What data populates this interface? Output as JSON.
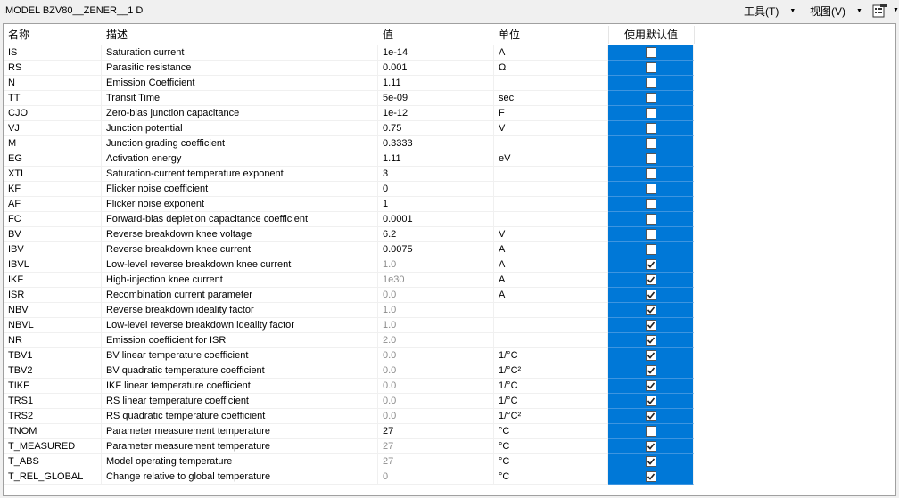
{
  "window": {
    "title": ".MODEL BZV80__ZENER__1 D"
  },
  "menu": {
    "tools": "工具(T)",
    "view": "视图(V)"
  },
  "icons": {
    "properties": "properties-icon",
    "dropdown": "dropdown-arrow-icon",
    "checkmark": "checkmark-icon"
  },
  "colors": {
    "selected": "#0078d7",
    "dim_text": "#8c8c8c"
  },
  "columns": {
    "name": "名称",
    "desc": "描述",
    "value": "值",
    "unit": "单位",
    "default": "使用默认值"
  },
  "rows": [
    {
      "name": "IS",
      "desc": "Saturation current",
      "value": "1e-14",
      "unit": "A",
      "default": false
    },
    {
      "name": "RS",
      "desc": "Parasitic resistance",
      "value": "0.001",
      "unit": "Ω",
      "default": false
    },
    {
      "name": "N",
      "desc": "Emission Coefficient",
      "value": "1.11",
      "unit": "",
      "default": false
    },
    {
      "name": "TT",
      "desc": "Transit Time",
      "value": "5e-09",
      "unit": "sec",
      "default": false
    },
    {
      "name": "CJO",
      "desc": "Zero-bias junction capacitance",
      "value": "1e-12",
      "unit": "F",
      "default": false
    },
    {
      "name": "VJ",
      "desc": "Junction potential",
      "value": "0.75",
      "unit": "V",
      "default": false
    },
    {
      "name": "M",
      "desc": "Junction grading coefficient",
      "value": "0.3333",
      "unit": "",
      "default": false
    },
    {
      "name": "EG",
      "desc": "Activation energy",
      "value": "1.11",
      "unit": "eV",
      "default": false
    },
    {
      "name": "XTI",
      "desc": "Saturation-current temperature exponent",
      "value": "3",
      "unit": "",
      "default": false
    },
    {
      "name": "KF",
      "desc": "Flicker noise coefficient",
      "value": "0",
      "unit": "",
      "default": false
    },
    {
      "name": "AF",
      "desc": "Flicker noise exponent",
      "value": "1",
      "unit": "",
      "default": false
    },
    {
      "name": "FC",
      "desc": "Forward-bias depletion capacitance coefficient",
      "value": "0.0001",
      "unit": "",
      "default": false
    },
    {
      "name": "BV",
      "desc": "Reverse breakdown knee voltage",
      "value": "6.2",
      "unit": "V",
      "default": false
    },
    {
      "name": "IBV",
      "desc": "Reverse breakdown knee current",
      "value": "0.0075",
      "unit": "A",
      "default": false
    },
    {
      "name": "IBVL",
      "desc": "Low-level reverse breakdown knee current",
      "value": "1.0",
      "unit": "A",
      "default": true
    },
    {
      "name": "IKF",
      "desc": "High-injection knee current",
      "value": "1e30",
      "unit": "A",
      "default": true
    },
    {
      "name": "ISR",
      "desc": "Recombination current parameter",
      "value": "0.0",
      "unit": "A",
      "default": true
    },
    {
      "name": "NBV",
      "desc": "Reverse breakdown ideality factor",
      "value": "1.0",
      "unit": "",
      "default": true
    },
    {
      "name": "NBVL",
      "desc": "Low-level reverse breakdown ideality factor",
      "value": "1.0",
      "unit": "",
      "default": true
    },
    {
      "name": "NR",
      "desc": "Emission coefficient for ISR",
      "value": "2.0",
      "unit": "",
      "default": true
    },
    {
      "name": "TBV1",
      "desc": "BV linear temperature coefficient",
      "value": "0.0",
      "unit": "1/°C",
      "default": true
    },
    {
      "name": "TBV2",
      "desc": "BV quadratic temperature coefficient",
      "value": "0.0",
      "unit": "1/°C²",
      "default": true
    },
    {
      "name": "TIKF",
      "desc": "IKF linear temperature coefficient",
      "value": "0.0",
      "unit": "1/°C",
      "default": true
    },
    {
      "name": "TRS1",
      "desc": "RS linear temperature coefficient",
      "value": "0.0",
      "unit": "1/°C",
      "default": true
    },
    {
      "name": "TRS2",
      "desc": "RS quadratic temperature coefficient",
      "value": "0.0",
      "unit": "1/°C²",
      "default": true
    },
    {
      "name": "TNOM",
      "desc": "Parameter measurement temperature",
      "value": "27",
      "unit": "°C",
      "default": false
    },
    {
      "name": "T_MEASURED",
      "desc": "Parameter measurement temperature",
      "value": "27",
      "unit": "°C",
      "default": true
    },
    {
      "name": "T_ABS",
      "desc": "Model operating temperature",
      "value": "27",
      "unit": "°C",
      "default": true
    },
    {
      "name": "T_REL_GLOBAL",
      "desc": "Change relative to global temperature",
      "value": "0",
      "unit": "°C",
      "default": true
    }
  ]
}
